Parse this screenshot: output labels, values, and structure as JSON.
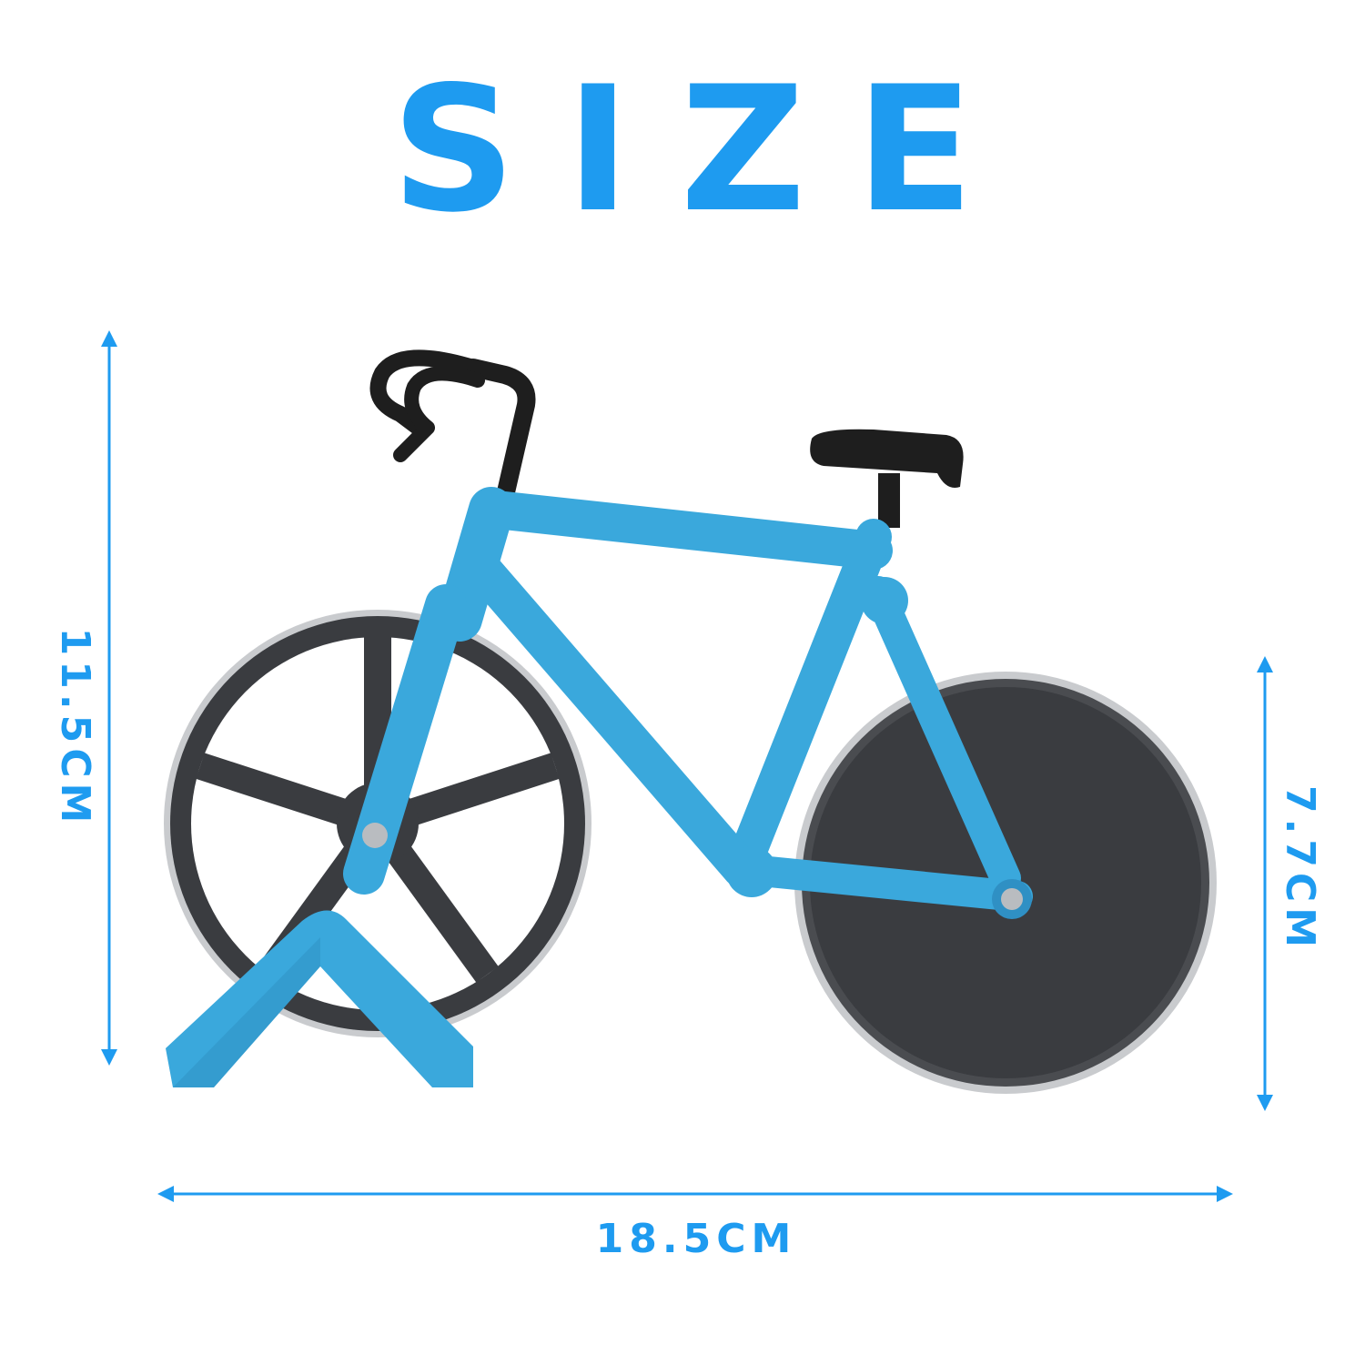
{
  "title": "SIZE",
  "dimensions": {
    "height": "11.5CM",
    "wheel_diameter": "7.7CM",
    "length": "18.5CM"
  },
  "colors": {
    "accent": "#1e9bf0",
    "frame_blue": "#3aa8dc",
    "frame_shadow": "#2a86b6",
    "wheel_dark": "#3a3c40",
    "handle_black": "#1e1e1e"
  }
}
